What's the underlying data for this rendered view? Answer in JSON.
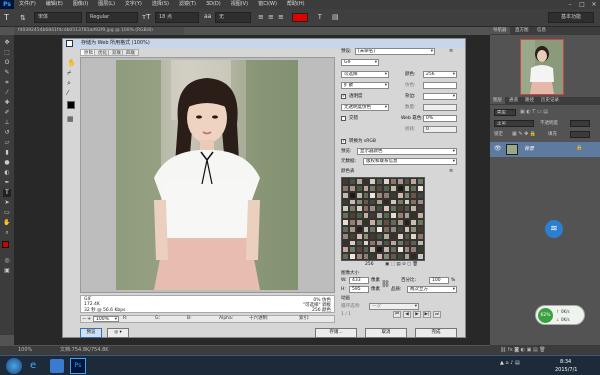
{
  "app": {
    "logo": "Ps"
  },
  "menu": [
    "文件(F)",
    "编辑(E)",
    "图像(I)",
    "图层(L)",
    "文字(Y)",
    "选择(S)",
    "滤镜(T)",
    "3D(D)",
    "视图(V)",
    "窗口(W)",
    "帮助(H)"
  ],
  "options": {
    "font_family": "宋体",
    "font_style": "Regular",
    "font_size": "18 点",
    "aa": "无",
    "preset": "基本功能"
  },
  "doc_tab": "fd0392454b6841f4cdb0513781ad92f9.jpg @ 100% (RGB/8)",
  "status": {
    "zoom": "100%",
    "doc_size": "文档:754.8K/754.8K"
  },
  "right_panel": {
    "nav_tabs": [
      "导航器",
      "直方图",
      "信息"
    ],
    "layer_tabs": [
      "图层",
      "通道",
      "路径",
      "历史记录"
    ],
    "kind": "类型",
    "blend_mode": "正常",
    "opacity_label": "不透明度",
    "lock_label": "锁定",
    "fill_label": "填充",
    "layer_name": "背景"
  },
  "widget": {
    "percent": "62%",
    "up": "0K/s",
    "down": "0K/s"
  },
  "dialog": {
    "title": "存储为 Web 所用格式 (100%)",
    "tabs": [
      "原稿",
      "优化",
      "双联",
      "四联"
    ],
    "preset_label": "预设:",
    "preset_value": "[未命名]",
    "format": "GIF",
    "reduction": "可选择",
    "colors_label": "颜色:",
    "colors_value": "256",
    "dither": "扩散",
    "dither_label": "仿色:",
    "dither_value": "",
    "transparency": "透明度",
    "matte_label": "杂边:",
    "trans_dither": "无透明度仿色",
    "amount_label": "数量:",
    "interlaced": "交错",
    "web_snap_label": "Web 靠色:",
    "web_snap_value": "0%",
    "lossy_label": "损耗:",
    "lossy_value": "0",
    "convert_srgb": "转换为 sRGB",
    "preview_label": "预览:",
    "preview_value": "显示器颜色",
    "metadata_label": "元数据:",
    "metadata_value": "版权和联系信息",
    "color_table": "颜色表",
    "color_count": "256",
    "image_size": "图像大小",
    "w_label": "W:",
    "w_value": "433",
    "h_label": "H:",
    "h_value": "595",
    "px_unit": "像素",
    "percent_label": "百分比:",
    "percent_value": "100",
    "pct": "%",
    "quality_label": "品质:",
    "quality_value": "两次立方",
    "animation": "动画",
    "loop_label": "循环选项:",
    "loop_value": "一次",
    "anim_frame": "1 / 1",
    "info_format": "GIF",
    "info_size": "172.4K",
    "info_time": "32 秒 @ 56.6 Kbps",
    "info_dither": "0% 仿色",
    "info_palette": "\"可选择\" 调板",
    "info_colors": "256 颜色",
    "zoom": "100%",
    "r_label": "R:",
    "g_label": "G:",
    "b_label": "B:",
    "alpha_label": "Alpha:",
    "hex_label": "十六进制:",
    "index_label": "索引:",
    "preview_btn": "预览",
    "save_btn": "存储...",
    "cancel_btn": "取消",
    "done_btn": "完成"
  },
  "taskbar": {
    "time": "8:34",
    "date": "2015/7/1"
  },
  "colors": {
    "accent": "#2a6fb0",
    "foreground": "#d00000",
    "background": "#ffffff"
  }
}
